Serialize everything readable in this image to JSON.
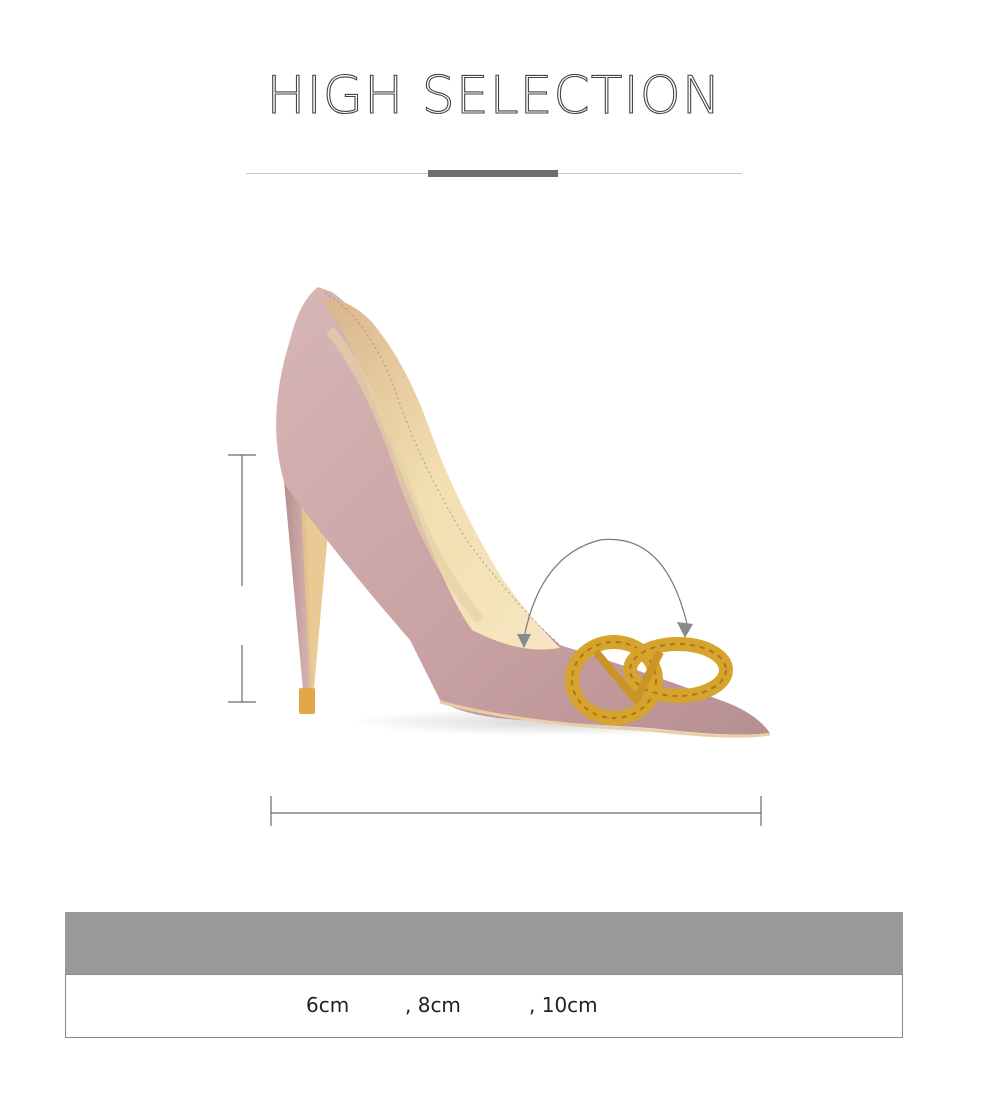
{
  "title": "HIGH SELECTION",
  "colors": {
    "shoe_body": "#c9a3a4",
    "shoe_lining": "#f0d9a8",
    "buckle": "#d9a62e",
    "header_bar": "#9a9a9a"
  },
  "heel_options": [
    {
      "label": "6cm"
    },
    {
      "label": ", 8cm"
    },
    {
      "label": ", 10cm"
    }
  ]
}
